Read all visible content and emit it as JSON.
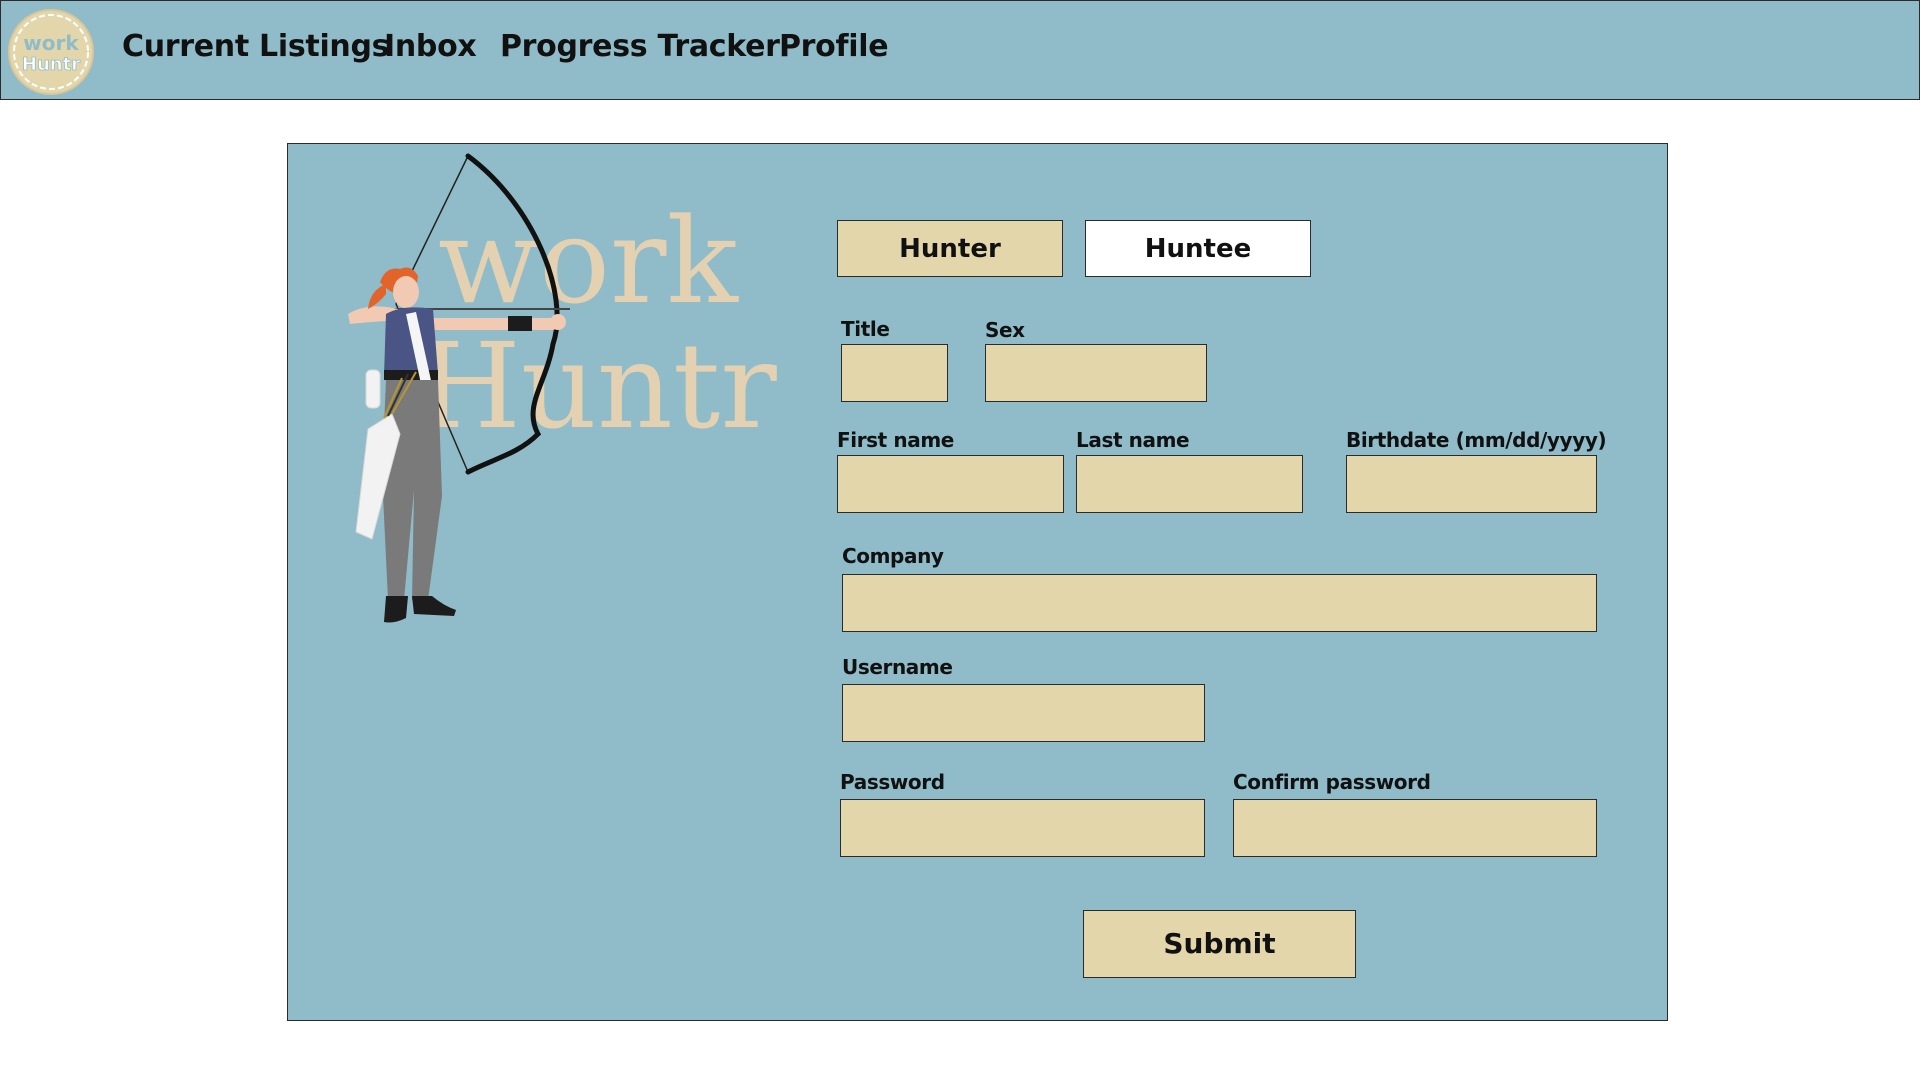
{
  "nav": {
    "logo_text_top": "work",
    "logo_text_bottom": "Huntr",
    "links": [
      "Current Listings",
      "Inbox",
      "Progress Tracker",
      "Profile"
    ]
  },
  "hero": {
    "brand_line1": "work",
    "brand_line2": "Huntr",
    "illustration": "archer-woman-with-bow"
  },
  "form": {
    "role_toggle": {
      "options": [
        "Hunter",
        "Huntee"
      ],
      "selected": "Hunter"
    },
    "fields": {
      "title": {
        "label": "Title",
        "value": ""
      },
      "sex": {
        "label": "Sex",
        "value": ""
      },
      "first_name": {
        "label": "First name",
        "value": ""
      },
      "last_name": {
        "label": "Last name",
        "value": ""
      },
      "birthdate": {
        "label": "Birthdate (mm/dd/yyyy)",
        "value": ""
      },
      "company": {
        "label": "Company",
        "value": ""
      },
      "username": {
        "label": "Username",
        "value": ""
      },
      "password": {
        "label": "Password",
        "value": ""
      },
      "confirm_password": {
        "label": "Confirm password",
        "value": ""
      }
    },
    "submit_label": "Submit"
  },
  "colors": {
    "panel_bg": "#8fbcc8",
    "input_bg": "#e3d6ab",
    "brand_text": "#e3d1b2"
  }
}
